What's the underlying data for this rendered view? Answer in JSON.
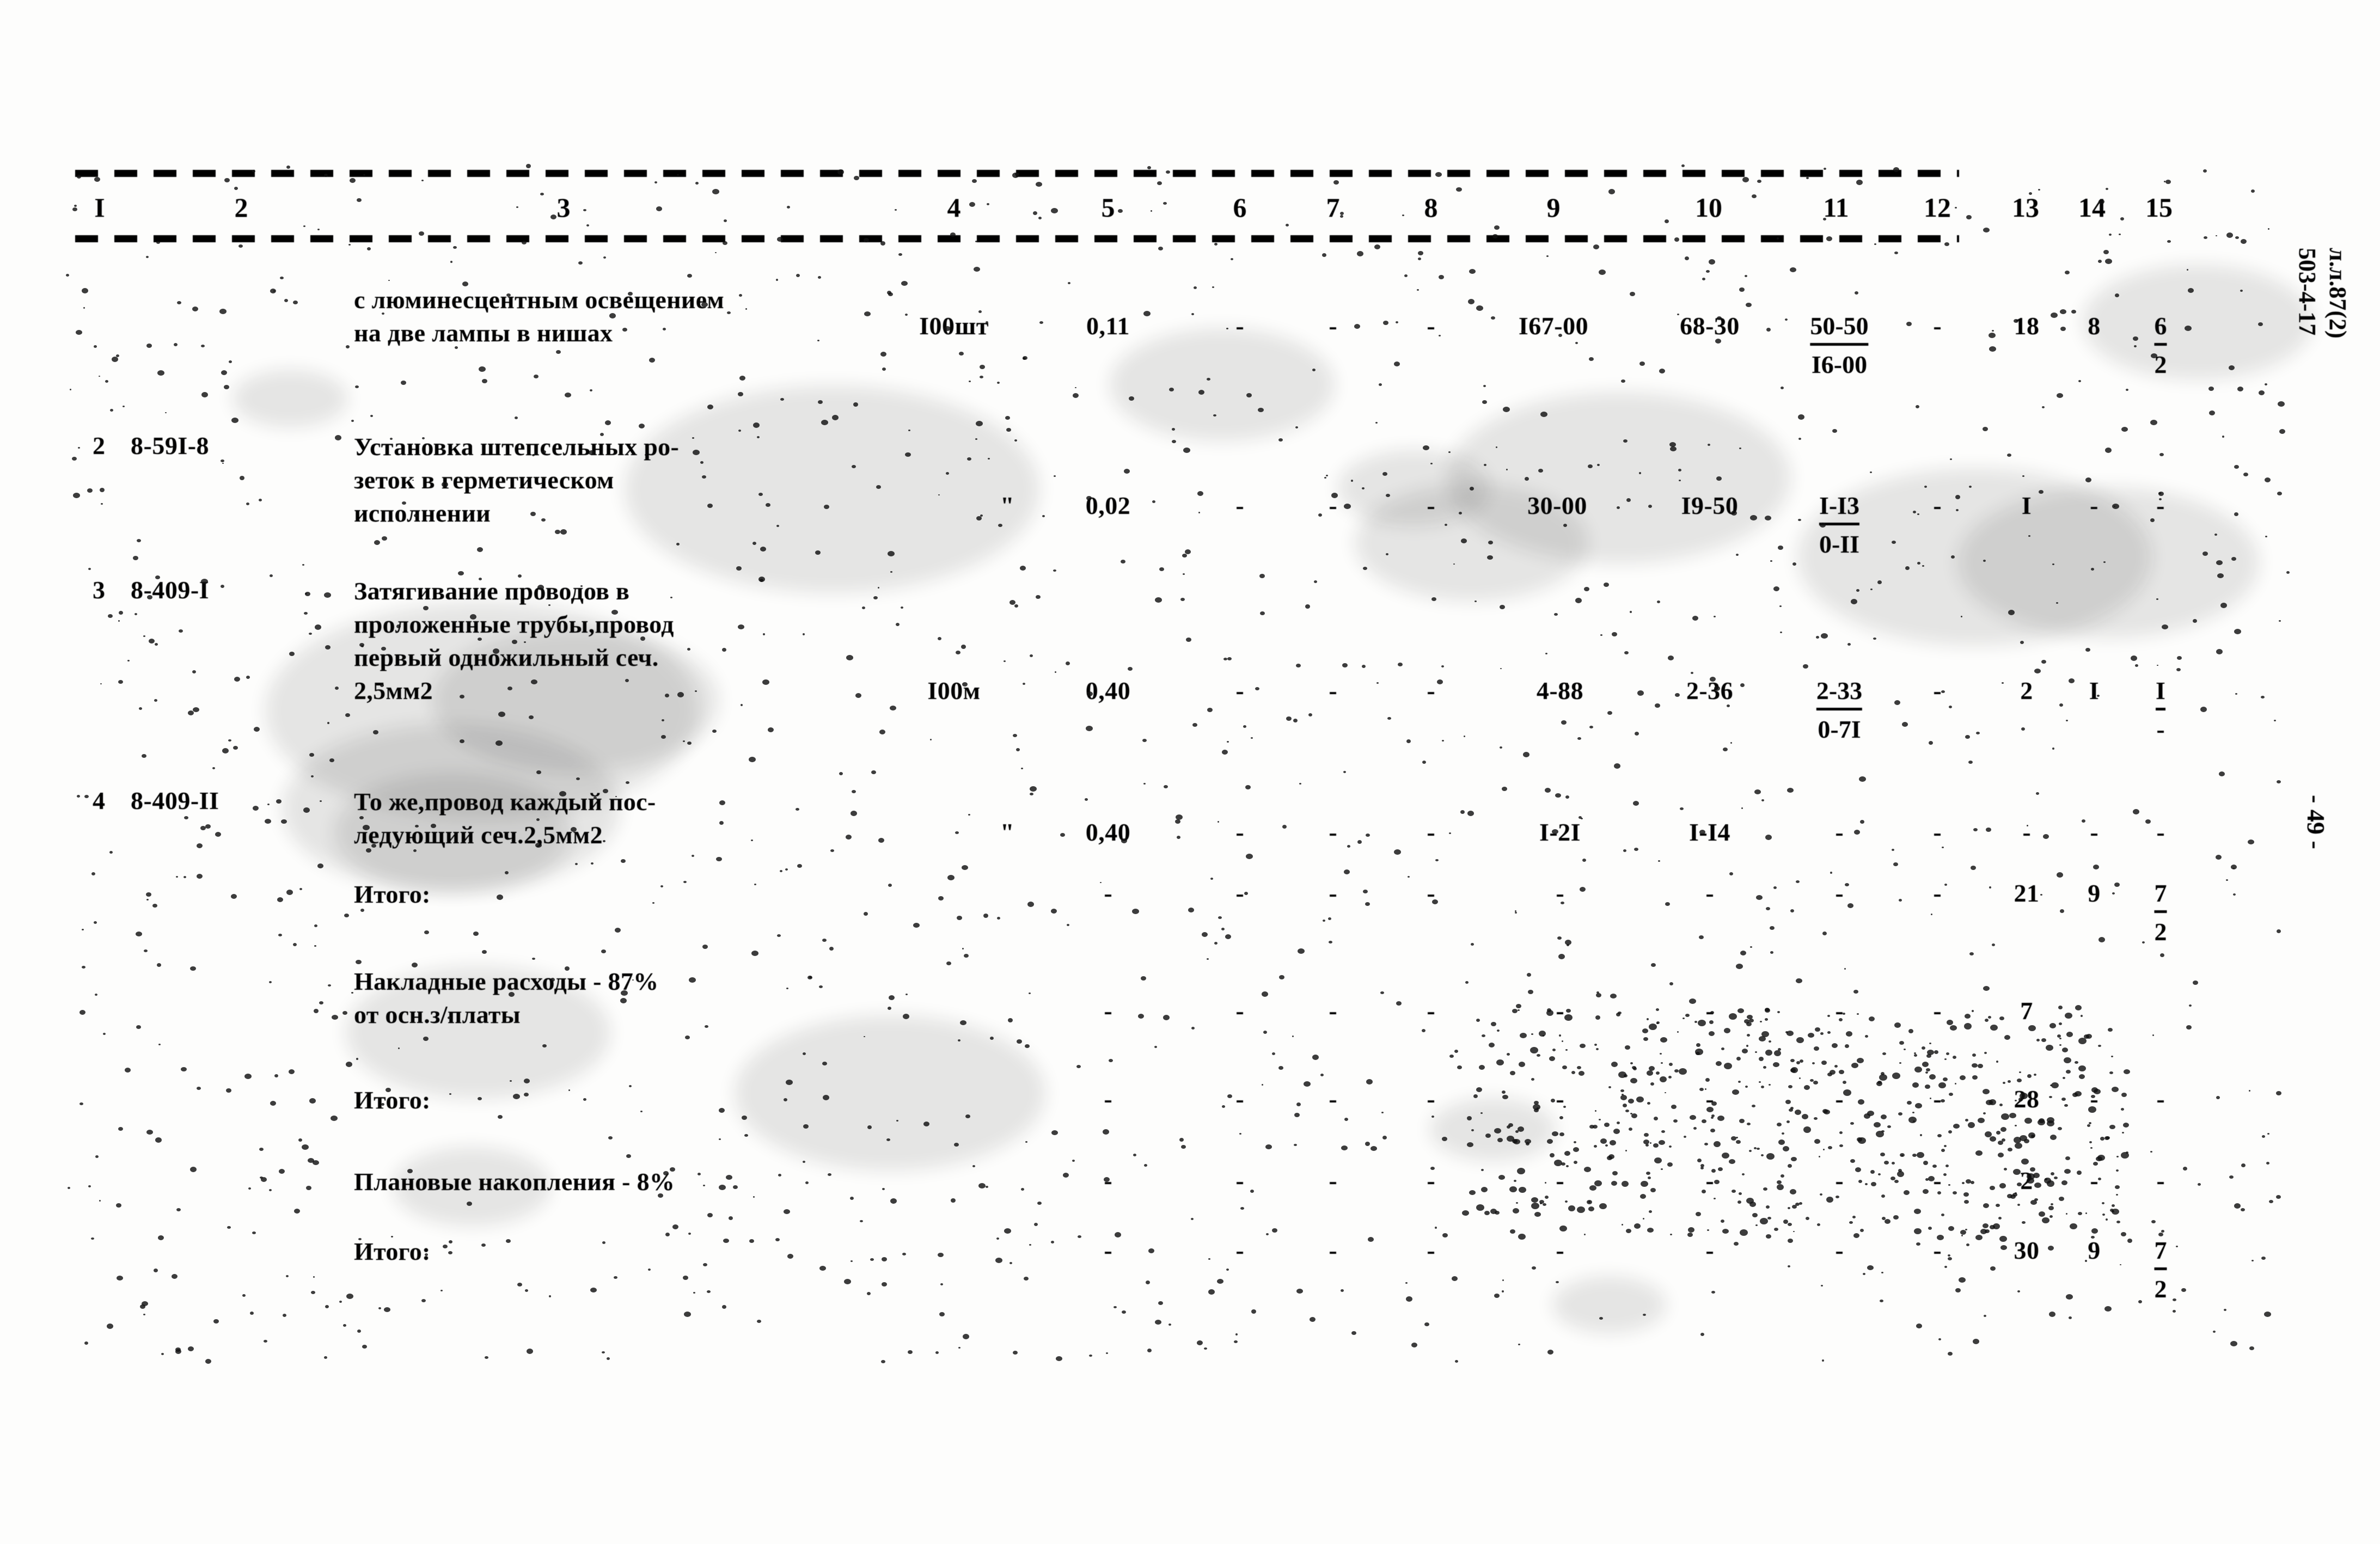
{
  "document": {
    "type": "soviet-construction-estimate-table",
    "margin_stamp_line1": "503-4-17",
    "margin_stamp_line2": "л.л.87(2)",
    "page_number": "- 49 -"
  },
  "table": {
    "column_headers": [
      "I",
      "2",
      "3",
      "4",
      "5",
      "6",
      "7",
      "8",
      "9",
      "10",
      "11",
      "12",
      "13",
      "14",
      "15"
    ],
    "rows": [
      {
        "no": "",
        "code": "",
        "description": "с люминесцентным освещением\nна две лампы в нишах",
        "unit": "I00шт",
        "qty": "0,11",
        "c6": "-",
        "c7": "-",
        "c8": "-",
        "c9": "I67-00",
        "c10": "68-30",
        "c11_num": "50-50",
        "c11_den": "I6-00",
        "c12": "-",
        "c13": "18",
        "c14": "8",
        "c15_num": "6",
        "c15_den": "2"
      },
      {
        "no": "2",
        "code": "8-59I-8",
        "description": "Установка штепсельных ро-\nзеток в герметическом\nисполнении",
        "unit": "\"",
        "qty": "0,02",
        "c6": "-",
        "c7": "-",
        "c8": "-",
        "c9": "30-00",
        "c10": "I9-50",
        "c11_num": "I-I3",
        "c11_den": "0-II",
        "c12": "-",
        "c13": "I",
        "c14": "-",
        "c15_num": "-",
        "c15_den": ""
      },
      {
        "no": "3",
        "code": "8-409-I",
        "description": "Затягивание проводов в\nпроложенные трубы,провод\nпервый одножильный сеч.\n2,5мм2",
        "unit": "I00м",
        "qty": "0,40",
        "c6": "-",
        "c7": "-",
        "c8": "-",
        "c9": "4-88",
        "c10": "2-36",
        "c11_num": "2-33",
        "c11_den": "0-7I",
        "c12": "-",
        "c13": "2",
        "c14": "I",
        "c15_num": "I",
        "c15_den": "-"
      },
      {
        "no": "4",
        "code": "8-409-II",
        "description": "То же,провод каждый пос-\nледующий сеч.2,5мм2",
        "unit": "\"",
        "qty": "0,40",
        "c6": "-",
        "c7": "-",
        "c8": "-",
        "c9": "I-2I",
        "c10": "I-I4",
        "c11_num": "-",
        "c11_den": "",
        "c12": "-",
        "c13": "-",
        "c14": "-",
        "c15_num": "-",
        "c15_den": ""
      }
    ],
    "summary_rows": [
      {
        "label": "Итого:",
        "c5": "-",
        "c6": "-",
        "c7": "-",
        "c8": "-",
        "c9": "-",
        "c10": "-",
        "c11": "-",
        "c12": "-",
        "c13": "21",
        "c14": "9",
        "c15_num": "7",
        "c15_den": "2"
      },
      {
        "label": "Накладные расходы - 87%\nот осн.з/платы",
        "c5": "-",
        "c6": "-",
        "c7": "-",
        "c8": "-",
        "c9": "-",
        "c10": "-",
        "c11": "-",
        "c12": "-",
        "c13": "7",
        "c14": "",
        "c15_num": "",
        "c15_den": ""
      },
      {
        "label": "Итого:",
        "c5": "-",
        "c6": "-",
        "c7": "-",
        "c8": "-",
        "c9": "-",
        "c10": "-",
        "c11": "-",
        "c12": "-",
        "c13": "28",
        "c14": "-",
        "c15_num": "-",
        "c15_den": ""
      },
      {
        "label": "Плановые накопления - 8%",
        "c5": "-",
        "c6": "-",
        "c7": "-",
        "c8": "-",
        "c9": "-",
        "c10": "-",
        "c11": "-",
        "c12": "-",
        "c13": "2",
        "c14": "-",
        "c15_num": "-",
        "c15_den": ""
      },
      {
        "label": "Итого:",
        "c5": "-",
        "c6": "-",
        "c7": "-",
        "c8": "-",
        "c9": "-",
        "c10": "-",
        "c11": "-",
        "c12": "-",
        "c13": "30",
        "c14": "9",
        "c15_num": "7",
        "c15_den": "2"
      }
    ]
  }
}
